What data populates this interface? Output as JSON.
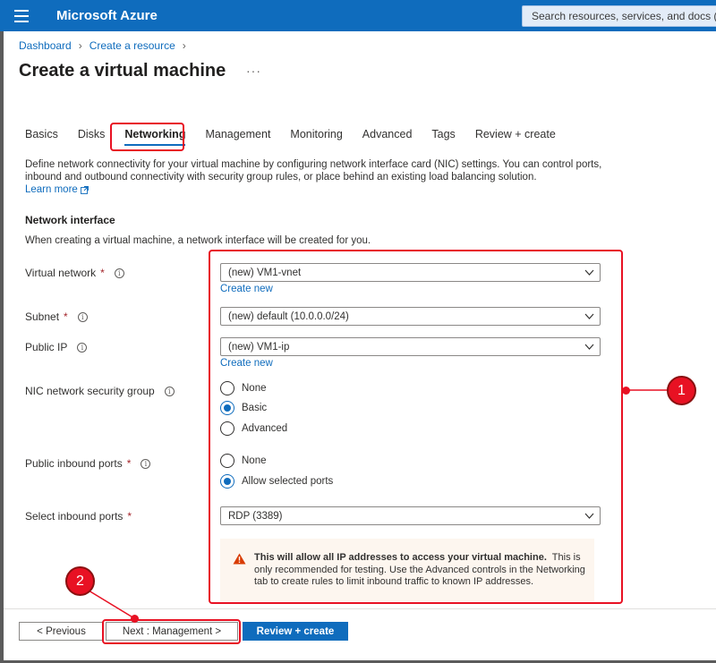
{
  "app": {
    "brand": "Microsoft Azure",
    "search_placeholder": "Search resources, services, and docs (G"
  },
  "breadcrumb": [
    "Dashboard",
    "Create a resource"
  ],
  "page": {
    "title": "Create a virtual machine",
    "more": "···"
  },
  "tabs": [
    {
      "label": "Basics",
      "active": false
    },
    {
      "label": "Disks",
      "active": false
    },
    {
      "label": "Networking",
      "active": true
    },
    {
      "label": "Management",
      "active": false
    },
    {
      "label": "Monitoring",
      "active": false
    },
    {
      "label": "Advanced",
      "active": false
    },
    {
      "label": "Tags",
      "active": false
    },
    {
      "label": "Review + create",
      "active": false
    }
  ],
  "intro": {
    "text": "Define network connectivity for your virtual machine by configuring network interface card (NIC) settings. You can control ports, inbound and outbound connectivity with security group rules, or place behind an existing load balancing solution.",
    "learn_more": "Learn more"
  },
  "network_interface": {
    "heading": "Network interface",
    "subtitle": "When creating a virtual machine, a network interface will be created for you."
  },
  "fields": {
    "virtual_network": {
      "label": "Virtual network",
      "value": "(new) VM1-vnet",
      "create_new": "Create new"
    },
    "subnet": {
      "label": "Subnet",
      "value": "(new) default (10.0.0.0/24)"
    },
    "public_ip": {
      "label": "Public IP",
      "value": "(new) VM1-ip",
      "create_new": "Create new"
    },
    "nic_nsg": {
      "label": "NIC network security group",
      "options": [
        "None",
        "Basic",
        "Advanced"
      ],
      "selected": "Basic"
    },
    "public_inbound_ports": {
      "label": "Public inbound ports",
      "options": [
        "None",
        "Allow selected ports"
      ],
      "selected": "Allow selected ports"
    },
    "select_inbound_ports": {
      "label": "Select inbound ports",
      "value": "RDP (3389)"
    }
  },
  "required_mark": "*",
  "info_glyph": "i",
  "warning": {
    "bold": "This will allow all IP addresses to access your virtual machine.",
    "text": "This is only recommended for testing.  Use the Advanced controls in the Networking tab to create rules to limit inbound traffic to known IP addresses."
  },
  "footer": {
    "previous": "< Previous",
    "next": "Next : Management >",
    "review": "Review + create"
  },
  "annotations": {
    "callout_1": "1",
    "callout_2": "2",
    "color": "#e81123"
  }
}
